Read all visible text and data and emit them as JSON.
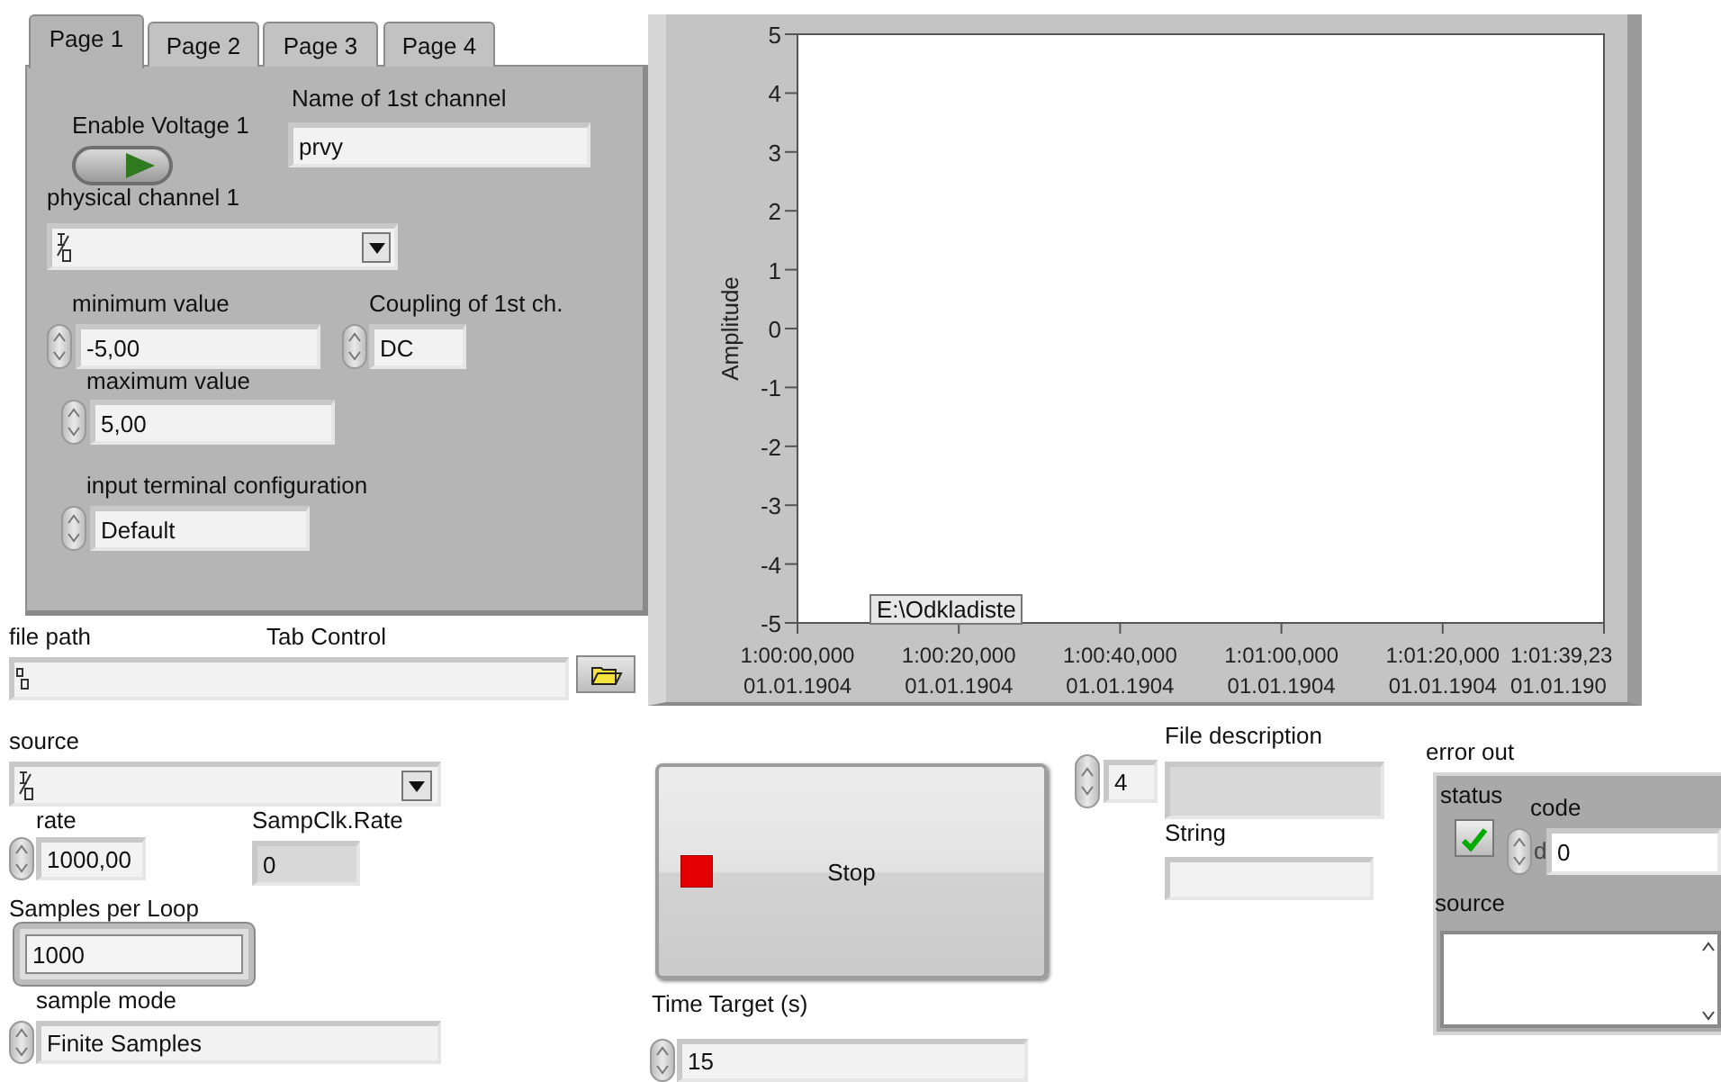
{
  "tab_control": {
    "label": "Tab Control",
    "tabs": [
      {
        "label": "Page 1",
        "selected": true
      },
      {
        "label": "Page 2",
        "selected": false
      },
      {
        "label": "Page 3",
        "selected": false
      },
      {
        "label": "Page 4",
        "selected": false
      }
    ],
    "enable_voltage": {
      "label": "Enable Voltage 1",
      "on": true
    },
    "channel_name": {
      "label": "Name of 1st channel",
      "value": "prvy"
    },
    "physical_channel": {
      "label": "physical channel 1"
    },
    "minimum_value": {
      "label": "minimum value",
      "value": "-5,00"
    },
    "coupling": {
      "label": "Coupling of 1st ch.",
      "value": "DC"
    },
    "maximum_value": {
      "label": "maximum value",
      "value": "5,00"
    },
    "terminal_config": {
      "label": "input terminal configuration",
      "value": "Default"
    }
  },
  "file_path": {
    "label": "file path"
  },
  "chart": {
    "path_tooltip": "E:\\Odkladiste",
    "chart_data": {
      "type": "line",
      "ylabel": "Amplitude",
      "ylim": [
        -5,
        5
      ],
      "yticks": [
        5,
        4,
        3,
        2,
        1,
        0,
        -1,
        -2,
        -3,
        -4,
        -5
      ],
      "categories": [
        "1:00:00,000 01.01.1904",
        "1:00:20,000 01.01.1904",
        "1:00:40,000 01.01.1904",
        "1:01:00,000 01.01.1904",
        "1:01:20,000 01.01.1904",
        "1:01:39,23 01.01.190"
      ]
    }
  },
  "source": {
    "label": "source"
  },
  "rate": {
    "label": "rate",
    "value": "1000,00"
  },
  "samp_clk_rate": {
    "label": "SampClk.Rate",
    "value": "0"
  },
  "samples_per_loop": {
    "label": "Samples per Loop",
    "value": "1000"
  },
  "sample_mode": {
    "label": "sample mode",
    "value": "Finite Samples"
  },
  "stop_button": {
    "label": "Stop"
  },
  "time_target": {
    "label": "Time Target (s)",
    "value": "15"
  },
  "numeric": {
    "value": "4"
  },
  "file_description": {
    "label": "File description"
  },
  "string": {
    "label": "String"
  },
  "error_out": {
    "label": "error out",
    "status_label": "status",
    "error": false,
    "code_label": "code",
    "code_radix": "d",
    "code": "0",
    "source_label": "source"
  }
}
